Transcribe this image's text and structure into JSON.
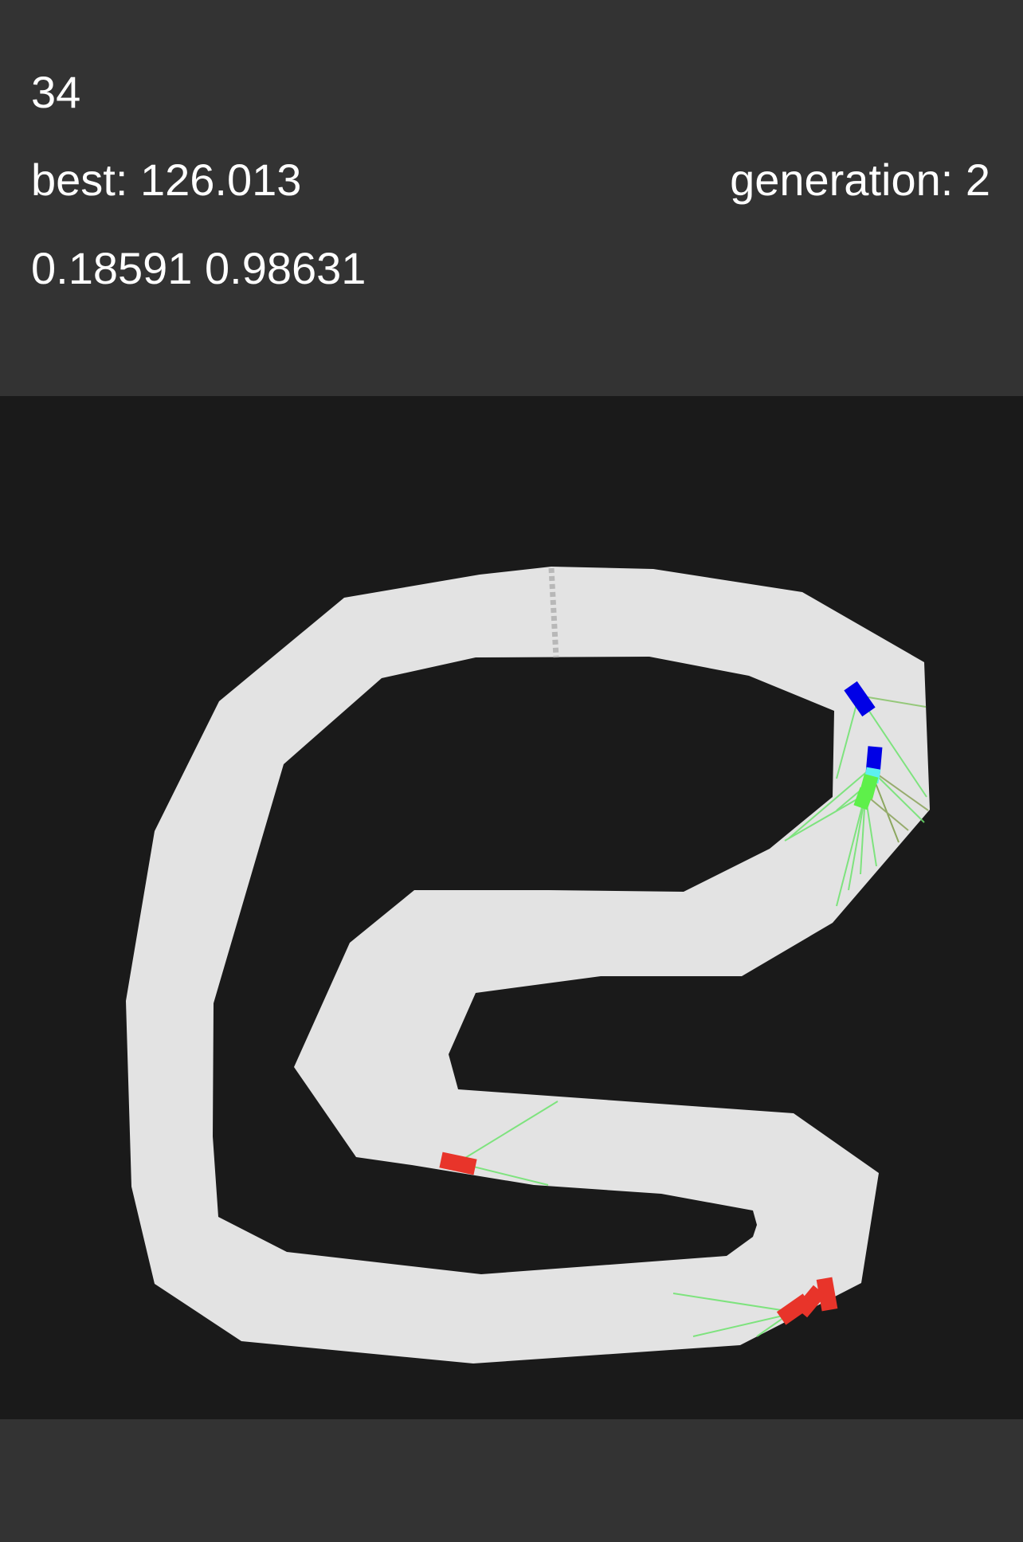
{
  "hud": {
    "tick": "34",
    "best": "best: 126.013",
    "generation": "generation: 2",
    "outputs": "0.18591 0.98631"
  },
  "colors": {
    "header_bg": "#333333",
    "canvas_bg": "#1a1a1a",
    "track": "#e3e3e3",
    "finish_line": "#bfbfbf",
    "car_best": "#0000e6",
    "car_cyan": "#5cf0f0",
    "car_alive": "#5ef04a",
    "car_dead": "#e8342a",
    "sensor_ray": "#6de36d"
  },
  "game": {
    "cars": [
      {
        "id": "car-blue-1",
        "state": "leader",
        "color": "#0000e6"
      },
      {
        "id": "car-blue-2",
        "state": "leader",
        "color": "#0000e6"
      },
      {
        "id": "car-cyan",
        "state": "alive",
        "color": "#5cf0f0"
      },
      {
        "id": "car-green-1",
        "state": "alive",
        "color": "#5ef04a"
      },
      {
        "id": "car-green-2",
        "state": "alive",
        "color": "#5ef04a"
      },
      {
        "id": "car-red-1",
        "state": "crashed",
        "color": "#e8342a"
      },
      {
        "id": "car-red-2",
        "state": "crashed",
        "color": "#e8342a"
      },
      {
        "id": "car-red-3",
        "state": "crashed",
        "color": "#e8342a"
      },
      {
        "id": "car-red-4",
        "state": "crashed",
        "color": "#e8342a"
      }
    ]
  }
}
